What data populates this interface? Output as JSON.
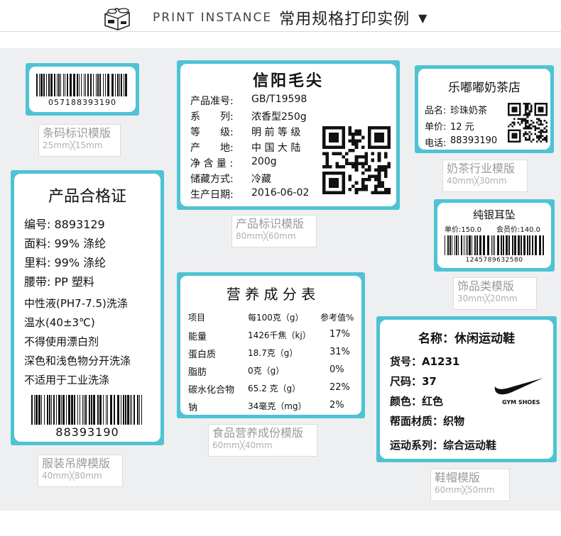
{
  "header": {
    "title_en": "PRINT INSTANCE",
    "title_zh": "常用规格打印实例",
    "arrow": "▼"
  },
  "templates": {
    "barcode": {
      "number": "057188393190",
      "caption": "条码标识模版",
      "size": "25mm╳15mm"
    },
    "garment": {
      "title": "产品合格证",
      "lines": [
        "编号: 8893129",
        "面料: 99% 涤纶",
        "里料: 99% 涤纶",
        "腰带: PP 塑料"
      ],
      "notes": [
        "中性液(PH7-7.5)洗涤",
        "温水(40±3℃)",
        "不得使用漂白剂",
        "深色和浅色物分开洗涤",
        "不适用于工业洗涤"
      ],
      "barcode_number": "88393190",
      "caption": "服装吊牌模版",
      "size": "40mm╳80mm"
    },
    "product": {
      "title": "信阳毛尖",
      "rows": [
        {
          "key": "产品准号:",
          "val": "GB/T19598"
        },
        {
          "key": "系　　列:",
          "val": "浓香型250g"
        },
        {
          "key": "等　　级:",
          "val": "明 前 等 级"
        },
        {
          "key": "产　　地:",
          "val": "中 国 大 陆"
        },
        {
          "key": "净 含 量 :",
          "val": "200g"
        },
        {
          "key": "储藏方式:",
          "val": "冷藏"
        },
        {
          "key": "生产日期:",
          "val": "2016-06-02"
        }
      ],
      "caption": "产品标识模版",
      "size": "80mm╳60mm"
    },
    "milktea": {
      "shop": "乐嘟嘟奶茶店",
      "rows": [
        {
          "key": "品名:",
          "val": "珍珠奶茶"
        },
        {
          "key": "单价:",
          "val": "12 元"
        },
        {
          "key": "电话:",
          "val": "88393190"
        }
      ],
      "caption": "奶茶行业模版",
      "size": "40mm╳30mm"
    },
    "jewelry": {
      "title": "纯银耳坠",
      "price_unit": "单价:150.0",
      "price_member": "会员价:140.0",
      "barcode_number": "1245789632580",
      "caption": "饰品类模版",
      "size": "30mm╳20mm"
    },
    "nutrition": {
      "title": "营 养 成 分 表",
      "headers": [
        "项目",
        "每100克（g）",
        "参考值%"
      ],
      "rows": [
        [
          "能量",
          "1426千焦（kj）",
          "17%"
        ],
        [
          "蛋白质",
          "18.7克（g）",
          "31%"
        ],
        [
          "脂肪",
          "0克（g）",
          "0%"
        ],
        [
          "碳水化合物",
          "65.2 克（g）",
          "22%"
        ],
        [
          "钠",
          "34毫克（mg）",
          "2%"
        ]
      ],
      "caption": "食品营养成份模版",
      "size": "60mm╳40mm"
    },
    "shoe": {
      "name": "名称：休闲运动鞋",
      "rows": [
        "货号：A1231",
        "尺码：37",
        "颜色：红色",
        "帮面材质：织物"
      ],
      "series": "运动系列：综合运动鞋",
      "brand": "GYM SHOES",
      "caption": "鞋帽模版",
      "size": "60mm╳50mm"
    }
  }
}
